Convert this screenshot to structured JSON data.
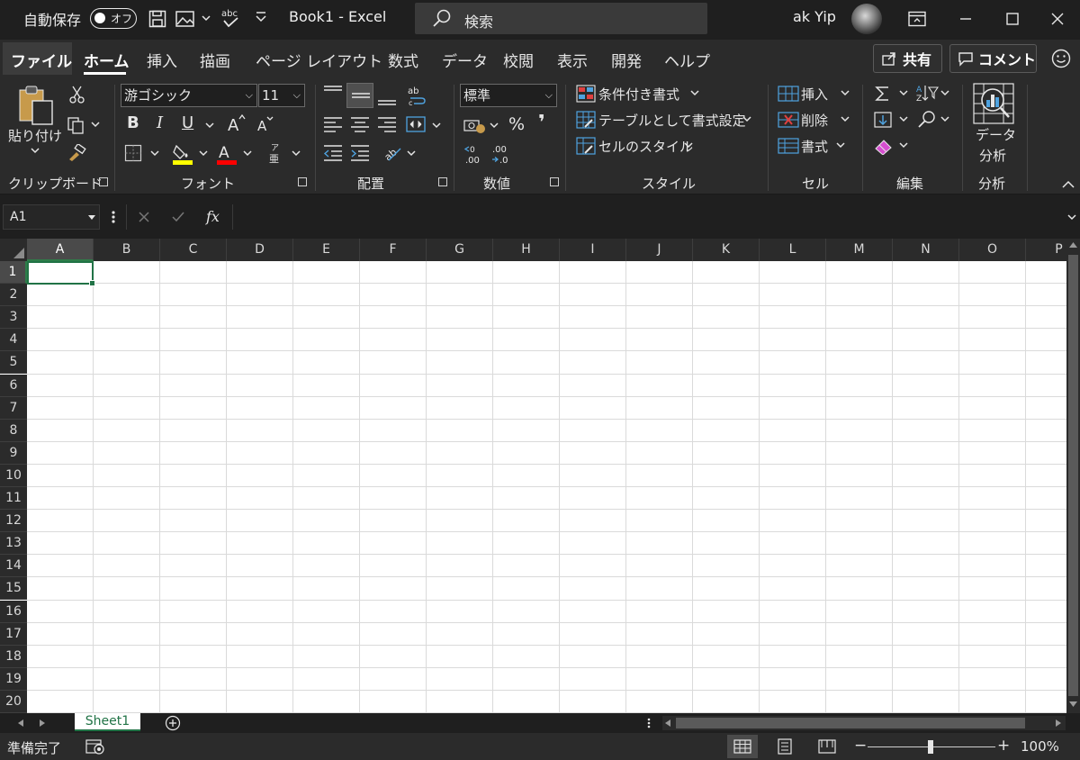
{
  "titlebar": {
    "autosave_label": "自動保存",
    "autosave_state": "オフ",
    "title": "Book1  -  Excel",
    "search_placeholder": "検索",
    "user_name": "ak Yip"
  },
  "tabs": [
    "ファイル",
    "ホーム",
    "挿入",
    "描画",
    "ページ レイアウト",
    "数式",
    "データ",
    "校閲",
    "表示",
    "開発",
    "ヘルプ"
  ],
  "active_tab": "ホーム",
  "ribbon_right": {
    "share_label": "共有",
    "comment_label": "コメント"
  },
  "ribbon": {
    "clipboard": {
      "paste_label": "貼り付け",
      "group_label": "クリップボード"
    },
    "font": {
      "font_name": "游ゴシック",
      "font_size": "11",
      "bold": "B",
      "italic": "I",
      "underline": "U",
      "group_label": "フォント"
    },
    "alignment": {
      "group_label": "配置"
    },
    "number": {
      "format": "標準",
      "percent": "%",
      "comma": "❜",
      "group_label": "数値"
    },
    "styles": {
      "conditional": "条件付き書式",
      "as_table": "テーブルとして書式設定",
      "cell_styles": "セルのスタイル",
      "group_label": "スタイル"
    },
    "cells": {
      "insert": "挿入",
      "delete": "削除",
      "format": "書式",
      "group_label": "セル"
    },
    "editing": {
      "group_label": "編集"
    },
    "analysis": {
      "button_line1": "データ",
      "button_line2": "分析",
      "group_label": "分析"
    }
  },
  "formula_bar": {
    "name_box": "A1",
    "fx": "fx",
    "formula": ""
  },
  "columns": [
    "A",
    "B",
    "C",
    "D",
    "E",
    "F",
    "G",
    "H",
    "I",
    "J",
    "K",
    "L",
    "M",
    "N",
    "O",
    "P"
  ],
  "rows": [
    "1",
    "2",
    "3",
    "4",
    "5",
    "6",
    "7",
    "8",
    "9",
    "10",
    "11",
    "12",
    "13",
    "14",
    "15",
    "16",
    "17",
    "18",
    "19",
    "20"
  ],
  "selected_cell": "A1",
  "sheets": [
    "Sheet1"
  ],
  "status": {
    "ready": "準備完了",
    "zoom": "100%",
    "zoom_level": 1.0
  },
  "colors": {
    "accent_green": "#217346",
    "dark_bg": "#1f1f1f",
    "ribbon_bg": "#2b2b2b"
  }
}
